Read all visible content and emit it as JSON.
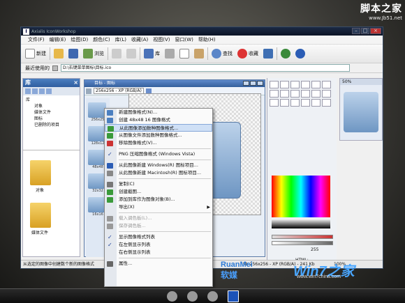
{
  "watermark": {
    "site_name": "脚本之家",
    "site_url": "www.Jb51.net"
  },
  "window": {
    "title": "Axialis IconWorkshop"
  },
  "menubar": [
    "文件(F)",
    "编辑(E)",
    "绘图(D)",
    "颜色(C)",
    "库(L)",
    "收藏(A)",
    "视图(V)",
    "窗口(W)",
    "帮助(H)"
  ],
  "toolbar": {
    "new": "新建",
    "browse": "浏览",
    "library": "库",
    "find": "查找",
    "favorites": "收藏"
  },
  "address": {
    "label": "最近使用的",
    "path": "D:\\右键菜单图标\\目标.ico"
  },
  "library_panel": {
    "title": "库",
    "tree": [
      "库",
      "对象",
      "媒体文件",
      "图标",
      "已删除的项目"
    ],
    "folders": [
      "对象",
      "媒体文件"
    ]
  },
  "document": {
    "title": "目标 - 图标",
    "format_select": "256x256 - XP (RGB/A)",
    "thumb_labels": [
      "256x25",
      "128x12",
      "48x48",
      "32x32",
      "16x16"
    ]
  },
  "context_menu": {
    "items": [
      {
        "label": "新建图像格式(N)...",
        "disabled": false
      },
      {
        "label": "创建 48x48 16 图像格式",
        "disabled": false
      },
      {
        "label": "从此图像添加数种图像格式...",
        "disabled": false,
        "highlight": true
      },
      {
        "label": "从图像文件添加数种图像格式...",
        "disabled": false
      },
      {
        "label": "移除图像格式(V)...",
        "disabled": false
      },
      {
        "sep": true
      },
      {
        "label": "PNG 压缩图像格式 (Windows Vista)",
        "check": true
      },
      {
        "sep": true
      },
      {
        "label": "从此图像新建 Windows(R) 图标项目...",
        "disabled": false
      },
      {
        "label": "从此图像新建 Macintosh(R) 图标项目...",
        "disabled": false
      },
      {
        "sep": true
      },
      {
        "label": "复制(C)",
        "disabled": false
      },
      {
        "label": "创建截图...",
        "disabled": false
      },
      {
        "label": "添加到库作为图像对象(B)...",
        "disabled": false
      },
      {
        "label": "导出(X)",
        "disabled": false,
        "submenu": true
      },
      {
        "sep": true
      },
      {
        "label": "载入调色板(L)...",
        "disabled": true
      },
      {
        "label": "保存调色板...",
        "disabled": true
      },
      {
        "sep": true
      },
      {
        "label": "显示图像格式列表",
        "check": true
      },
      {
        "label": "在左侧显示列表",
        "check": true
      },
      {
        "label": "在右侧显示列表",
        "disabled": false
      },
      {
        "sep": true
      },
      {
        "label": "属性...",
        "disabled": false
      }
    ]
  },
  "right_panel": {
    "opacity_value": "255",
    "html_label": "HTML:"
  },
  "preview": {
    "zoom": "50%"
  },
  "statusbar": {
    "hint": "从选定的图像中创建数个新的图像格式",
    "format": "Kb  256x256 - XP (RGB/A) - 241 Kb",
    "zoom": "100%"
  },
  "logos": {
    "ruanmei_en": "RuanMei",
    "ruanmei_cn": "软媒",
    "win7_text": "Win7之家",
    "win7_url": "www.win7china.com"
  }
}
